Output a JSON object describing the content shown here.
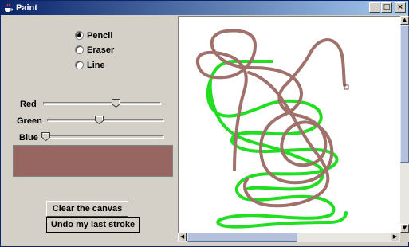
{
  "window": {
    "title": "Paint"
  },
  "tools": [
    {
      "label": "Pencil",
      "selected": true
    },
    {
      "label": "Eraser",
      "selected": false
    },
    {
      "label": "Line",
      "selected": false
    }
  ],
  "sliders": [
    {
      "label": "Red",
      "value": 160,
      "max": 255
    },
    {
      "label": "Green",
      "value": 112,
      "max": 255
    },
    {
      "label": "Blue",
      "value": 0,
      "max": 255
    }
  ],
  "color_preview": {
    "color": "#a0706a"
  },
  "buttons": {
    "clear": "Clear the canvas",
    "undo": "Undo my last stroke"
  },
  "stroke_colors": {
    "green": "#22dd22",
    "brown": "#a0706a"
  }
}
